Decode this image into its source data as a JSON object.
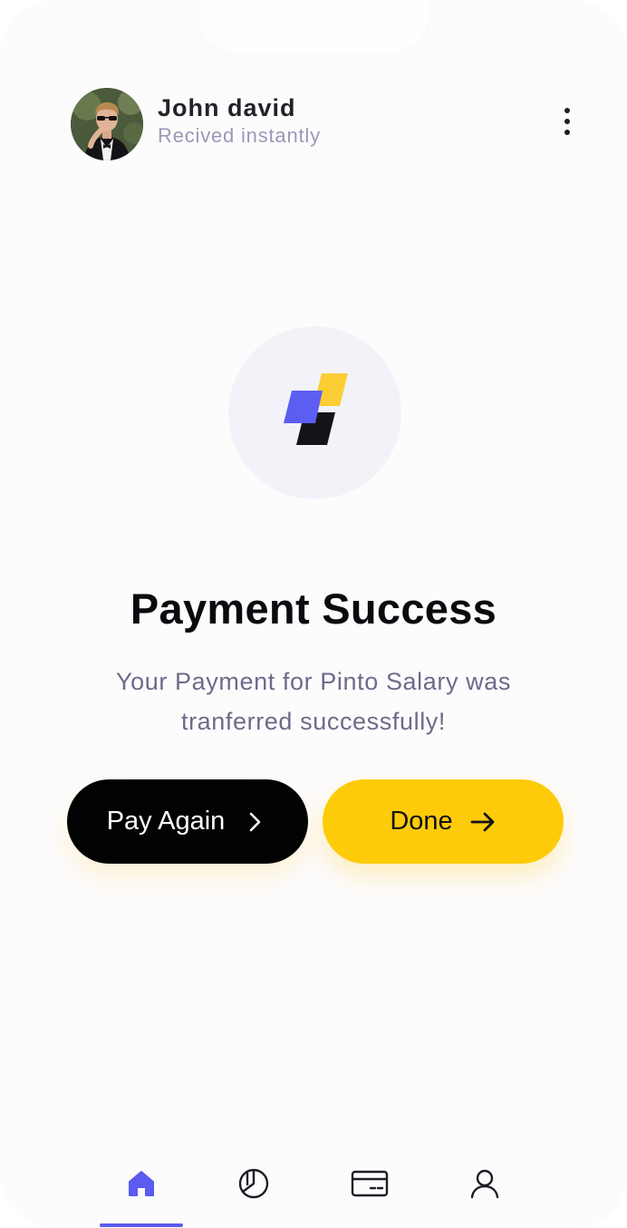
{
  "header": {
    "user_name": "John david",
    "subtitle": "Recived instantly"
  },
  "icons": {
    "menu": "more-vertical-icon",
    "logo": "app-logo-icon",
    "pay_again_arrow": "chevron-right-icon",
    "done_arrow": "arrow-right-icon",
    "nav_home": "home-icon",
    "nav_stats": "pie-chart-icon",
    "nav_cards": "credit-card-icon",
    "nav_profile": "user-icon"
  },
  "main": {
    "title": "Payment Success",
    "message": "Your Payment for Pinto Salary was tranferred successfully!"
  },
  "buttons": {
    "pay_again": "Pay Again",
    "done": "Done"
  },
  "nav": {
    "active": "home"
  },
  "colors": {
    "accent": "#5b5bf0",
    "primary_yellow": "#fdcb09",
    "dark": "#020203",
    "muted_text": "#6e6a8a"
  }
}
